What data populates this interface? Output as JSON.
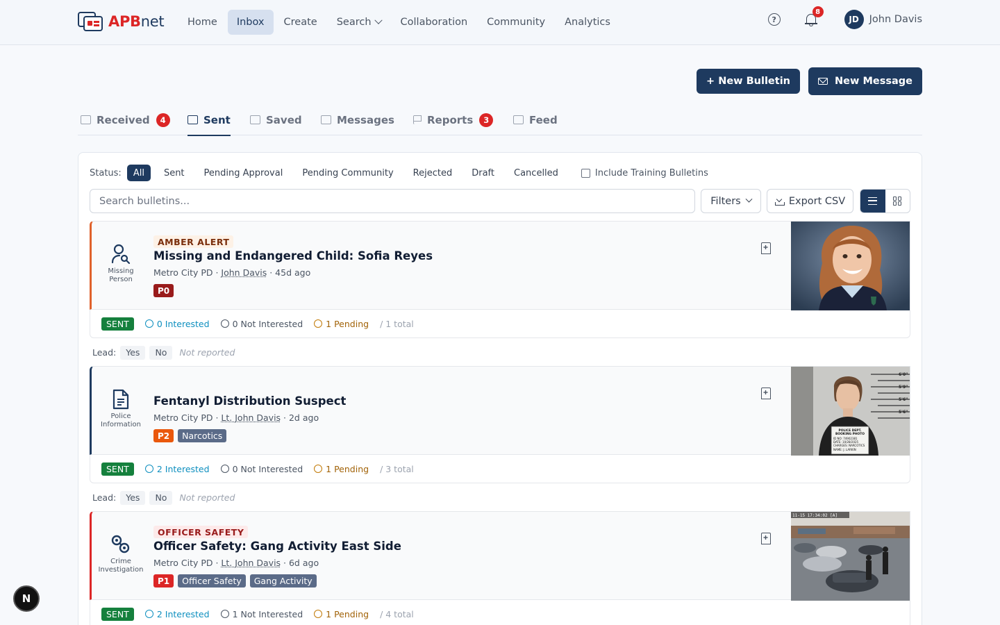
{
  "brand": {
    "apb": "APB",
    "net": "net"
  },
  "nav": {
    "items": [
      "Home",
      "Inbox",
      "Create",
      "Search",
      "Collaboration",
      "Community",
      "Analytics"
    ],
    "active": "Inbox"
  },
  "header": {
    "help_label": "?",
    "notifications_count": "8",
    "user_initials": "JD",
    "user_name": "John Davis"
  },
  "actions": {
    "new_bulletin": "+ New Bulletin",
    "new_message": "New Message"
  },
  "tabs": [
    {
      "label": "Received",
      "count": "4"
    },
    {
      "label": "Sent",
      "count": ""
    },
    {
      "label": "Saved",
      "count": ""
    },
    {
      "label": "Messages",
      "count": ""
    },
    {
      "label": "Reports",
      "count": "3"
    },
    {
      "label": "Feed",
      "count": ""
    }
  ],
  "active_tab": "Sent",
  "filters": {
    "status_label": "Status:",
    "statuses": [
      "All",
      "Sent",
      "Pending Approval",
      "Pending Community",
      "Rejected",
      "Draft",
      "Cancelled"
    ],
    "active_status": "All",
    "training_label": "Include Training Bulletins",
    "search_placeholder": "Search bulletins...",
    "filters_label": "Filters",
    "export_label": "Export CSV"
  },
  "colors": {
    "primary": "#1e3a5f",
    "danger": "#dc2626",
    "success": "#15803d"
  },
  "bulletins": [
    {
      "category": [
        "Missing",
        "Person"
      ],
      "category_icon": "person-search-icon",
      "alert": "AMBER ALERT",
      "title": "Missing and Endangered Child: Sofia Reyes",
      "agency": "Metro City PD",
      "author": "John Davis",
      "age": "45d ago",
      "priority": "P0",
      "tags": [],
      "status": "SENT",
      "interested": "0 Interested",
      "not_interested": "0 Not Interested",
      "pending": "1 Pending",
      "total": "/ 1 total",
      "lead_label": "Lead:",
      "lead_yes": "Yes",
      "lead_no": "No",
      "lead_status": "Not reported"
    },
    {
      "category": [
        "Police",
        "Information"
      ],
      "category_icon": "document-icon",
      "alert": "",
      "title": "Fentanyl Distribution Suspect",
      "agency": "Metro City PD",
      "author": "Lt. John Davis",
      "age": "2d ago",
      "priority": "P2",
      "tags": [
        "Narcotics"
      ],
      "status": "SENT",
      "interested": "2 Interested",
      "not_interested": "0 Not Interested",
      "pending": "1 Pending",
      "total": "/ 3 total",
      "lead_label": "Lead:",
      "lead_yes": "Yes",
      "lead_no": "No",
      "lead_status": "Not reported"
    },
    {
      "category": [
        "Crime",
        "Investigation"
      ],
      "category_icon": "handcuffs-icon",
      "alert": "OFFICER SAFETY",
      "title": "Officer Safety: Gang Activity East Side",
      "agency": "Metro City PD",
      "author": "Lt. John Davis",
      "age": "6d ago",
      "priority": "P1",
      "tags": [
        "Officer Safety",
        "Gang Activity"
      ],
      "status": "SENT",
      "interested": "2 Interested",
      "not_interested": "1 Not Interested",
      "pending": "1 Pending",
      "total": "/ 4 total"
    }
  ],
  "mugshot": {
    "height_marks": [
      "6'0\"",
      "5'9\"",
      "5'6\"",
      "5'6\""
    ],
    "placard": [
      "POLICE DEPT.",
      "BOOKING PHOTO",
      "ID NO: 74902381",
      "DATE: 10/28/2025",
      "CHARGES: NARCOTICS",
      "NAME: J. LARKIN"
    ]
  },
  "cctv": {
    "timestamp": "11-15 17:34:02 [A]"
  },
  "dev_badge": "N"
}
